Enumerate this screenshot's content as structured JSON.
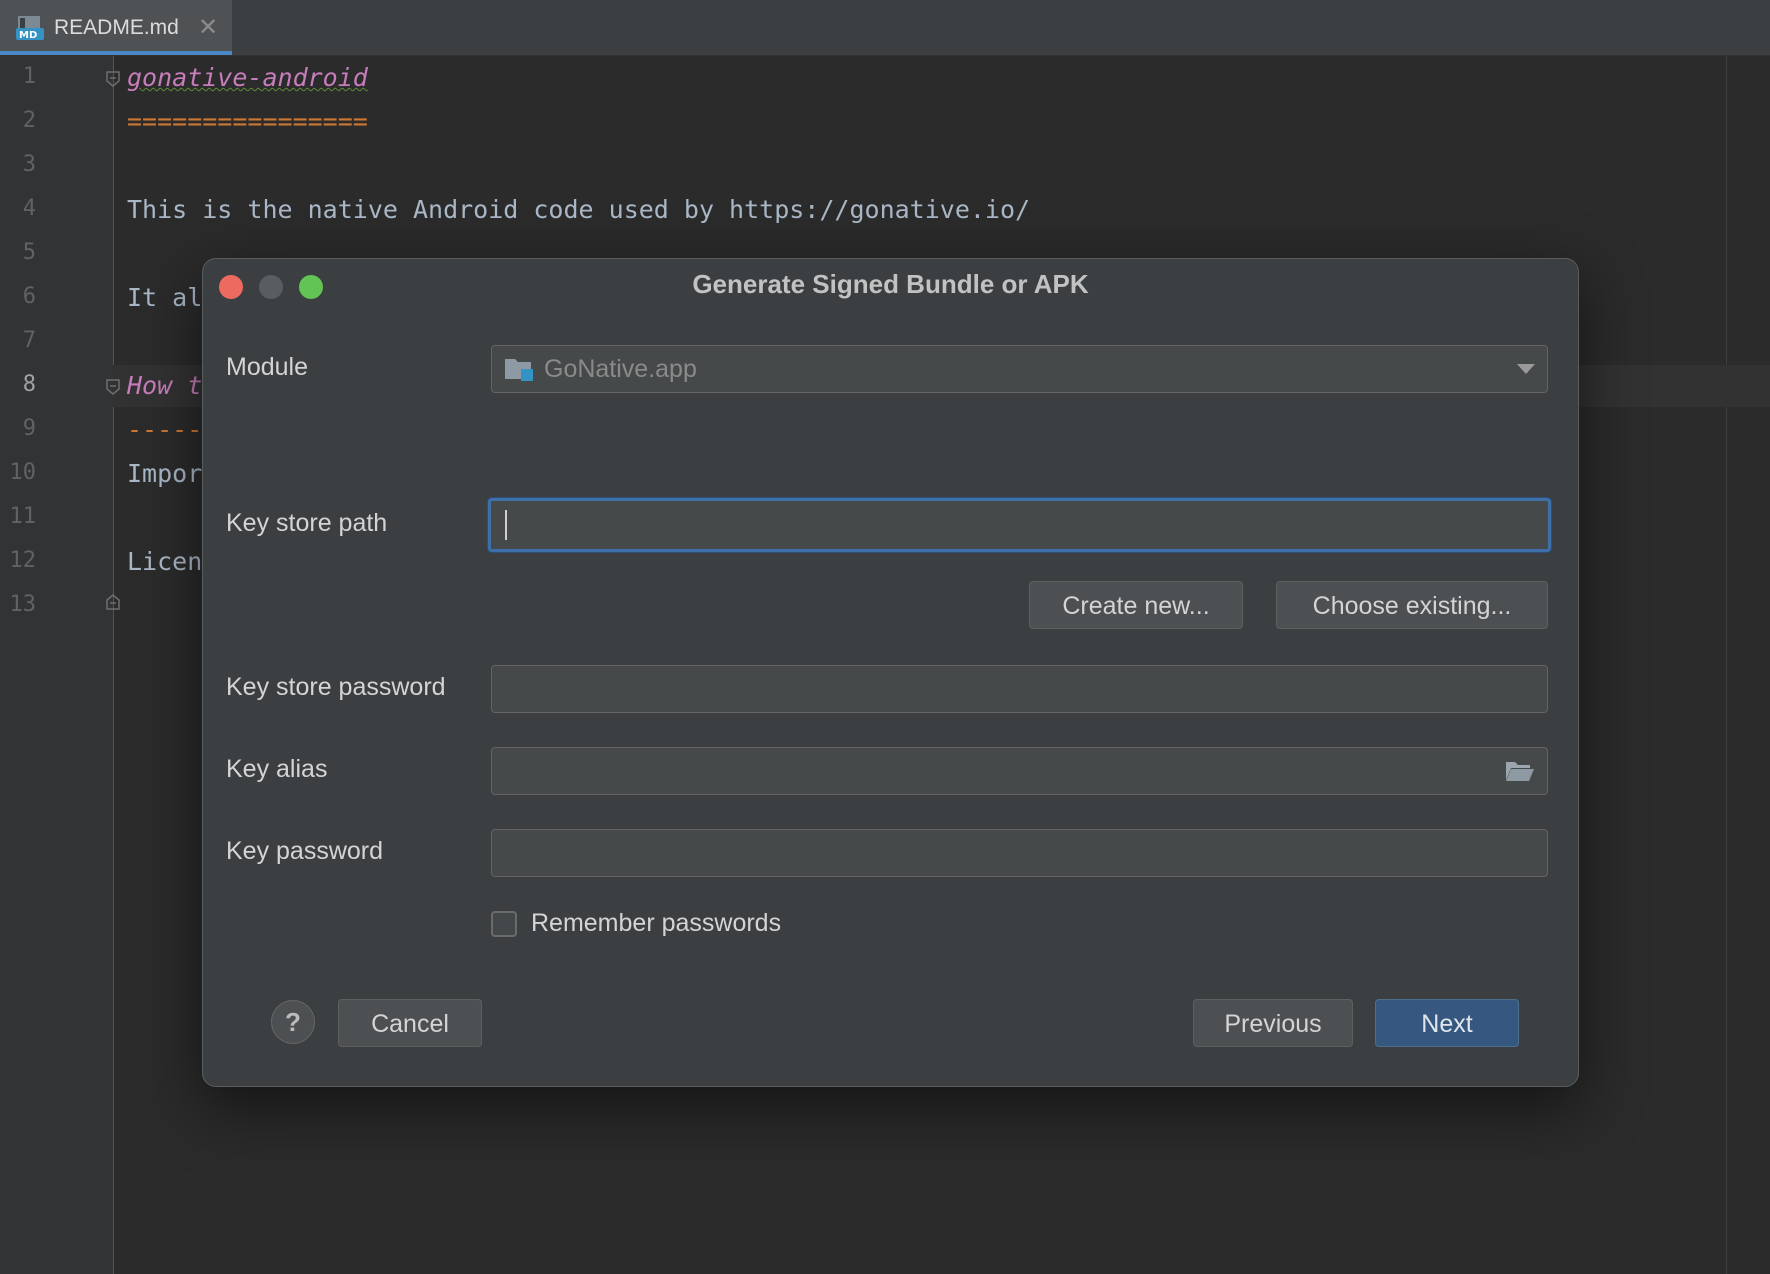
{
  "tab": {
    "label": "README.md",
    "icon": "markdown-file-icon",
    "close": "✕"
  },
  "editor": {
    "line_numbers": [
      "1",
      "2",
      "3",
      "4",
      "5",
      "6",
      "7",
      "8",
      "9",
      "10",
      "11",
      "12",
      "13"
    ],
    "active_line": "8",
    "lines": {
      "l1": "gonative-android",
      "l2": "================",
      "l4": "This is the native Android code used by https://gonative.io/",
      "l6": "It al",
      "l8": "How t",
      "l9": "-----",
      "l10": "Impor",
      "l12": "Licen"
    }
  },
  "dialog": {
    "title": "Generate Signed Bundle or APK",
    "module": {
      "label": "Module",
      "value": "GoNative.app"
    },
    "key_store_path": {
      "label": "Key store path",
      "value": ""
    },
    "create_new_label": "Create new...",
    "choose_existing_label": "Choose existing...",
    "key_store_password": {
      "label": "Key store password",
      "value": ""
    },
    "key_alias": {
      "label": "Key alias",
      "value": ""
    },
    "key_password": {
      "label": "Key password",
      "value": ""
    },
    "remember_passwords": {
      "label": "Remember passwords",
      "checked": false
    },
    "help_label": "?",
    "cancel_label": "Cancel",
    "previous_label": "Previous",
    "next_label": "Next"
  },
  "colors": {
    "accent": "#365880",
    "focus_border": "#3d6fa8",
    "traffic_close": "#ed6a5e",
    "traffic_max": "#61c454"
  }
}
